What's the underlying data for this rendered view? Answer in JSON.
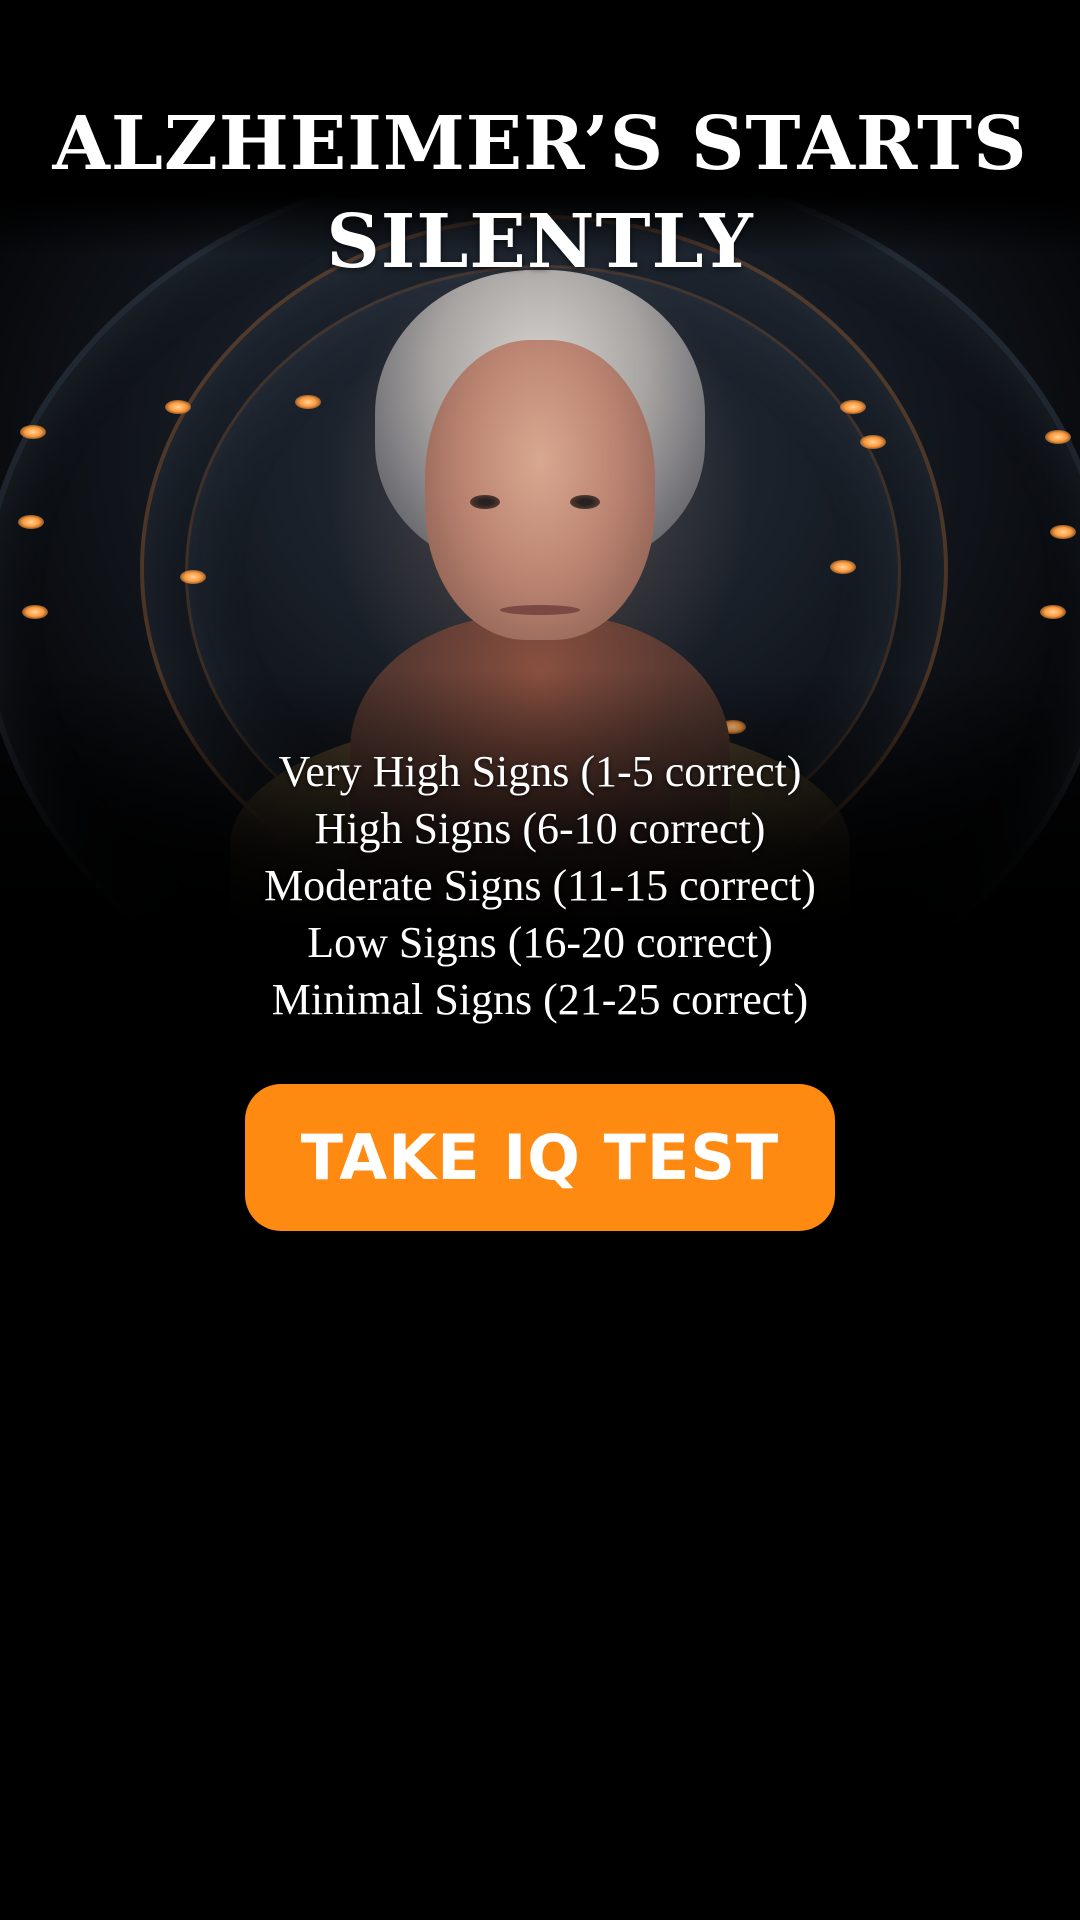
{
  "headline": {
    "line1": "ALZHEIMER’S STARTS",
    "line2": "SILENTLY"
  },
  "hero_image": {
    "subject": "elderly woman portrait",
    "colors": {
      "glow": "#ff9a3c",
      "background": "#151a22"
    }
  },
  "score_ranges": [
    "Very High Signs  (1-5 correct)",
    "High Signs  (6-10 correct)",
    "Moderate Signs  (11-15 correct)",
    "Low Signs  (16-20 correct)",
    "Minimal Signs  (21-25 correct)"
  ],
  "cta": {
    "label": "TAKE IQ TEST",
    "color": "#ff8a12"
  }
}
